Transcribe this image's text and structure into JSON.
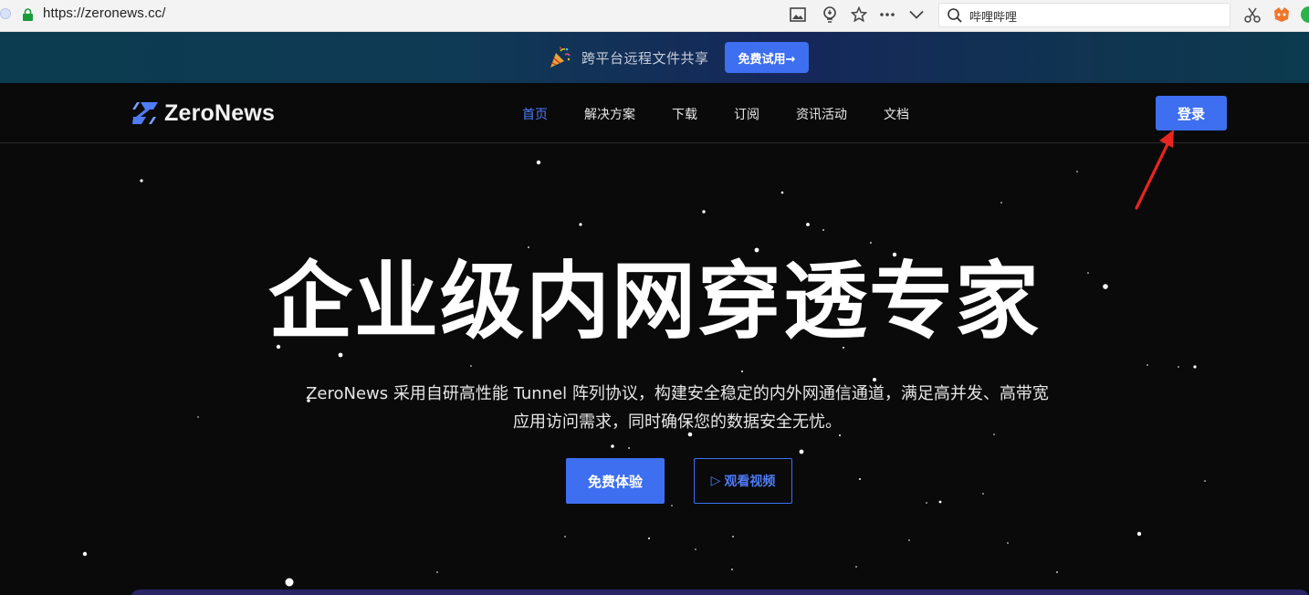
{
  "browser": {
    "url": "https://zeronews.cc/",
    "search_text": "哔哩哔哩",
    "icons": [
      "image-icon",
      "bulb-icon",
      "star-icon",
      "more-icon",
      "chevron-down-icon",
      "search-icon",
      "scissors-icon",
      "extension-icon"
    ]
  },
  "promo": {
    "text": "跨平台远程文件共享",
    "button": "免费试用→"
  },
  "nav": {
    "logo_text": "ZeroNews",
    "items": [
      {
        "label": "首页",
        "active": true
      },
      {
        "label": "解决方案",
        "active": false
      },
      {
        "label": "下载",
        "active": false
      },
      {
        "label": "订阅",
        "active": false
      },
      {
        "label": "资讯活动",
        "active": false
      },
      {
        "label": "文档",
        "active": false
      }
    ],
    "login": "登录"
  },
  "hero": {
    "title": "企业级内网穿透专家",
    "subtitle_line1": "ZeroNews 采用自研高性能 Tunnel 阵列协议，构建安全稳定的内外网通信通道，满足高并发、高带宽",
    "subtitle_line2": "应用访问需求，同时确保您的数据安全无忧。",
    "primary_button": "免费体验",
    "secondary_button": "观看视频",
    "secondary_icon": "▷"
  },
  "colors": {
    "accent": "#3d6ff0",
    "active_nav": "#4f7cf7",
    "background": "#0a0a0b",
    "annotation_arrow": "#e8251f"
  }
}
